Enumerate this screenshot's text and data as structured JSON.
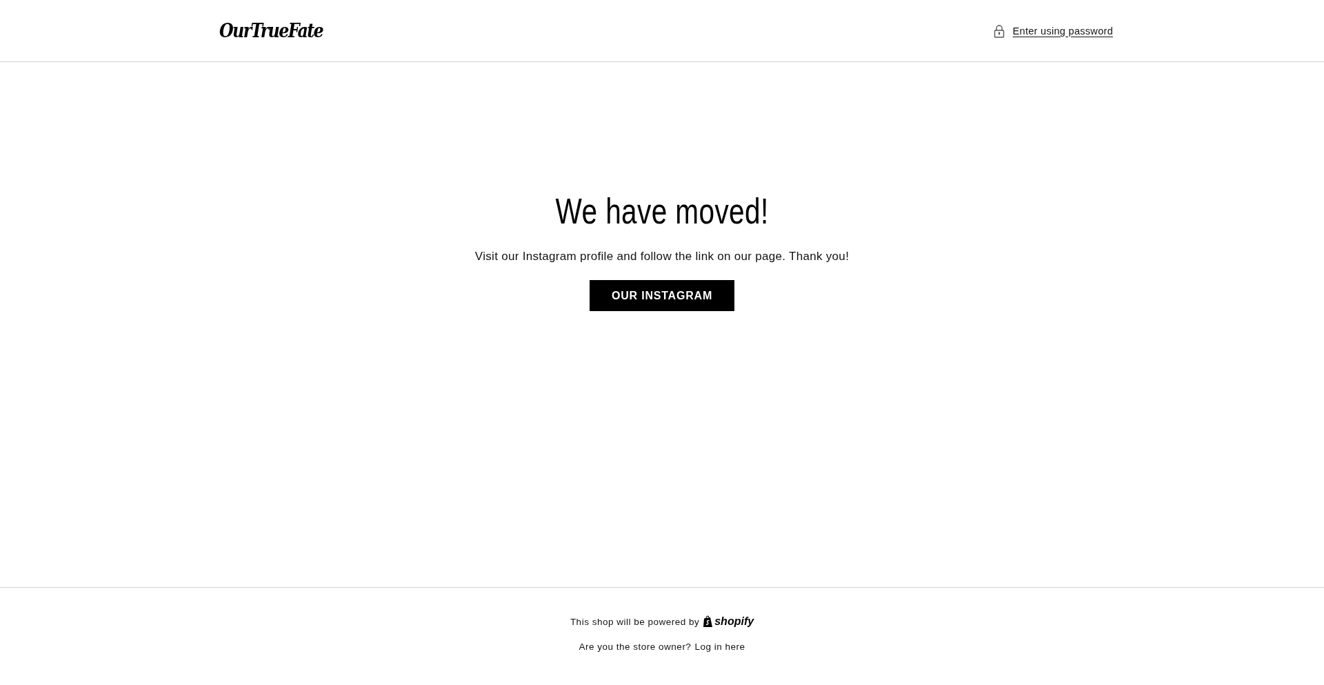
{
  "header": {
    "logo": "OurTrueFate",
    "password_link": "Enter using password"
  },
  "main": {
    "heading": "We have moved!",
    "text": "Visit our Instagram profile and follow the link on our page. Thank you!",
    "button": "OUR INSTAGRAM"
  },
  "footer": {
    "powered_by": "This shop will be powered by",
    "shopify_logo": "shopify",
    "owner_question": "Are you the store owner?",
    "login_link": "Log in here"
  }
}
